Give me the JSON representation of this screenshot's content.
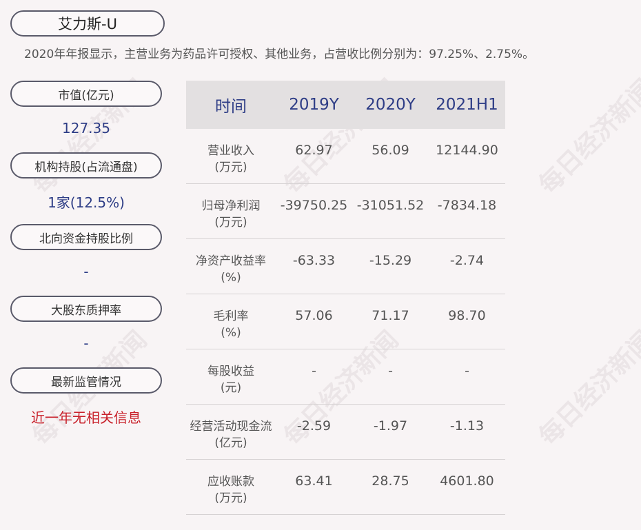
{
  "company": "艾力斯-U",
  "summary": "2020年年报显示，主营业务为药品许可授权、其他业务，占营收比例分别为：97.25%、2.75%。",
  "left_panel": [
    {
      "label": "市值(亿元)",
      "value": "127.35"
    },
    {
      "label": "机构持股(占流通盘)",
      "value": "1家(12.5%)"
    },
    {
      "label": "北向资金持股比例",
      "value": "-"
    },
    {
      "label": "大股东质押率",
      "value": "-"
    },
    {
      "label": "最新监管情况",
      "value": "近一年无相关信息"
    }
  ],
  "table": {
    "headers": [
      "时间",
      "2019Y",
      "2020Y",
      "2021H1"
    ],
    "rows": [
      {
        "label": "营业收入",
        "unit": "(万元)",
        "values": [
          "62.97",
          "56.09",
          "12144.90"
        ]
      },
      {
        "label": "归母净利润",
        "unit": "(万元)",
        "values": [
          "-39750.25",
          "-31051.52",
          "-7834.18"
        ]
      },
      {
        "label": "净资产收益率",
        "unit": "(%)",
        "values": [
          "-63.33",
          "-15.29",
          "-2.74"
        ]
      },
      {
        "label": "毛利率",
        "unit": "(%)",
        "values": [
          "57.06",
          "71.17",
          "98.70"
        ]
      },
      {
        "label": "每股收益",
        "unit": "(元)",
        "values": [
          "-",
          "-",
          "-"
        ]
      },
      {
        "label": "经营活动现金流",
        "unit": "(亿元)",
        "values": [
          "-2.59",
          "-1.97",
          "-1.13"
        ]
      },
      {
        "label": "应收账款",
        "unit": "(万元)",
        "values": [
          "63.41",
          "28.75",
          "4601.80"
        ]
      }
    ]
  },
  "watermark": "每日经济新闻",
  "colors": {
    "accent_blue": "#2e3d86",
    "alert_red": "#c8202a",
    "header_bg": "#e3e0e1"
  }
}
